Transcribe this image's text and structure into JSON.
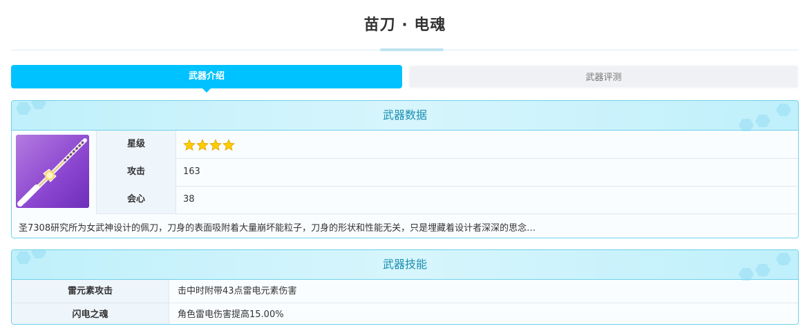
{
  "page": {
    "title": "苗刀 · 电魂"
  },
  "tabs": [
    {
      "label": "武器介绍",
      "active": true
    },
    {
      "label": "武器评测",
      "active": false
    }
  ],
  "weapon_data": {
    "heading": "武器数据",
    "image_icon": "katana-weapon-icon",
    "rows": [
      {
        "label": "星级",
        "stars": 4
      },
      {
        "label": "攻击",
        "value": "163"
      },
      {
        "label": "会心",
        "value": "38"
      }
    ],
    "description": "圣7308研究所为女武神设计的佩刀，刀身的表面吸附着大量崩坏能粒子，刀身的形状和性能无关，只是埋藏着设计者深深的思念…"
  },
  "weapon_skill": {
    "heading": "武器技能",
    "rows": [
      {
        "label": "雷元素攻击",
        "value": "击中时附带43点雷电元素伤害"
      },
      {
        "label": "闪电之魂",
        "value": "角色雷电伤害提高15.00%"
      }
    ]
  },
  "colors": {
    "accent": "#00c2ff",
    "panel_border": "#6fd1ea",
    "heading_text": "#1a8fb0",
    "star": "#ffcc00"
  }
}
